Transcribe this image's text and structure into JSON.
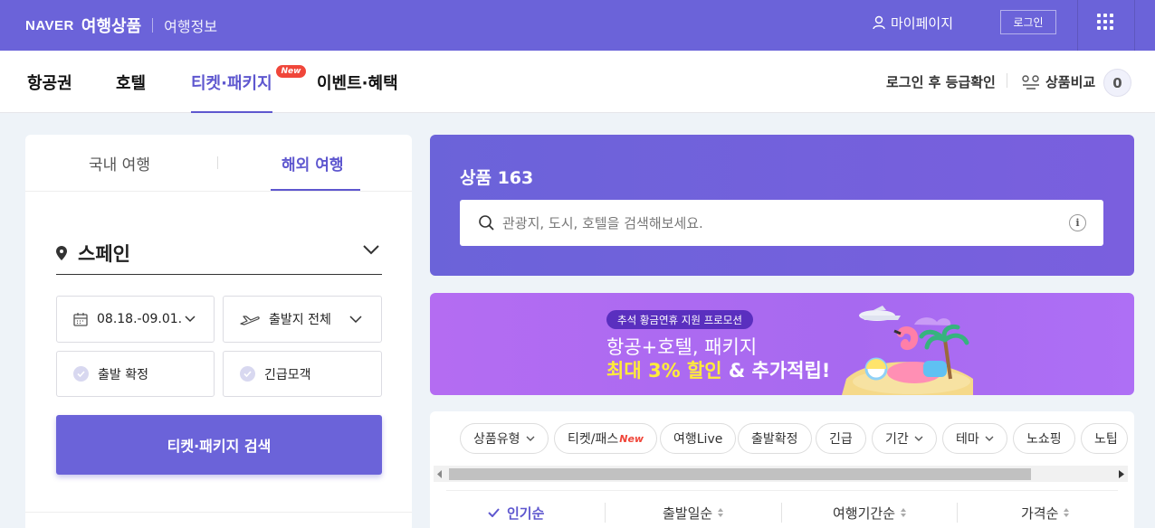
{
  "colors": {
    "primary": "#6b63d9",
    "accent_text": "#5e57cf",
    "new_badge": "#f0463a",
    "promo_highlight": "#ffec3a"
  },
  "header": {
    "naver": "NAVER",
    "product": "여행상품",
    "info": "여행정보",
    "mypage": "마이페이지",
    "login": "로그인",
    "apps_icon": "grid-icon"
  },
  "nav": {
    "items": [
      "항공권",
      "호텔",
      "티켓·패키지",
      "이벤트·혜택"
    ],
    "active": "티켓·패키지",
    "new_badge": "New",
    "login_grade": "로그인 후 등급확인",
    "compare": "상품비교",
    "compare_count": "0"
  },
  "left": {
    "tabs": [
      "국내 여행",
      "해외 여행"
    ],
    "active_tab": "해외 여행",
    "destination": "스페인",
    "dates": "08.18.-09.01.",
    "departure": "출발지 전체",
    "option1": "출발 확정",
    "option2": "긴급모객",
    "search_button": "티켓·패키지 검색"
  },
  "search": {
    "title": "상품 163",
    "placeholder": "관광지, 도시, 호텔을 검색해보세요."
  },
  "promo": {
    "pill": "추석 황금연휴 지원 프로모션",
    "line1": "항공+호텔, 패키지",
    "highlight": "최대 3% 할인",
    "rest": "& 추가적립!"
  },
  "filters": {
    "chips": [
      {
        "label": "상품유형",
        "dropdown": true
      },
      {
        "label": "티켓/패스",
        "new": "New"
      },
      {
        "label": "여행Live"
      },
      {
        "label": "출발확정"
      },
      {
        "label": "긴급"
      },
      {
        "label": "기간",
        "dropdown": true
      },
      {
        "label": "테마",
        "dropdown": true
      },
      {
        "label": "노쇼핑"
      },
      {
        "label": "노팁"
      }
    ]
  },
  "sort": {
    "items": [
      "인기순",
      "출발일순",
      "여행기간순",
      "가격순"
    ],
    "active": "인기순"
  }
}
